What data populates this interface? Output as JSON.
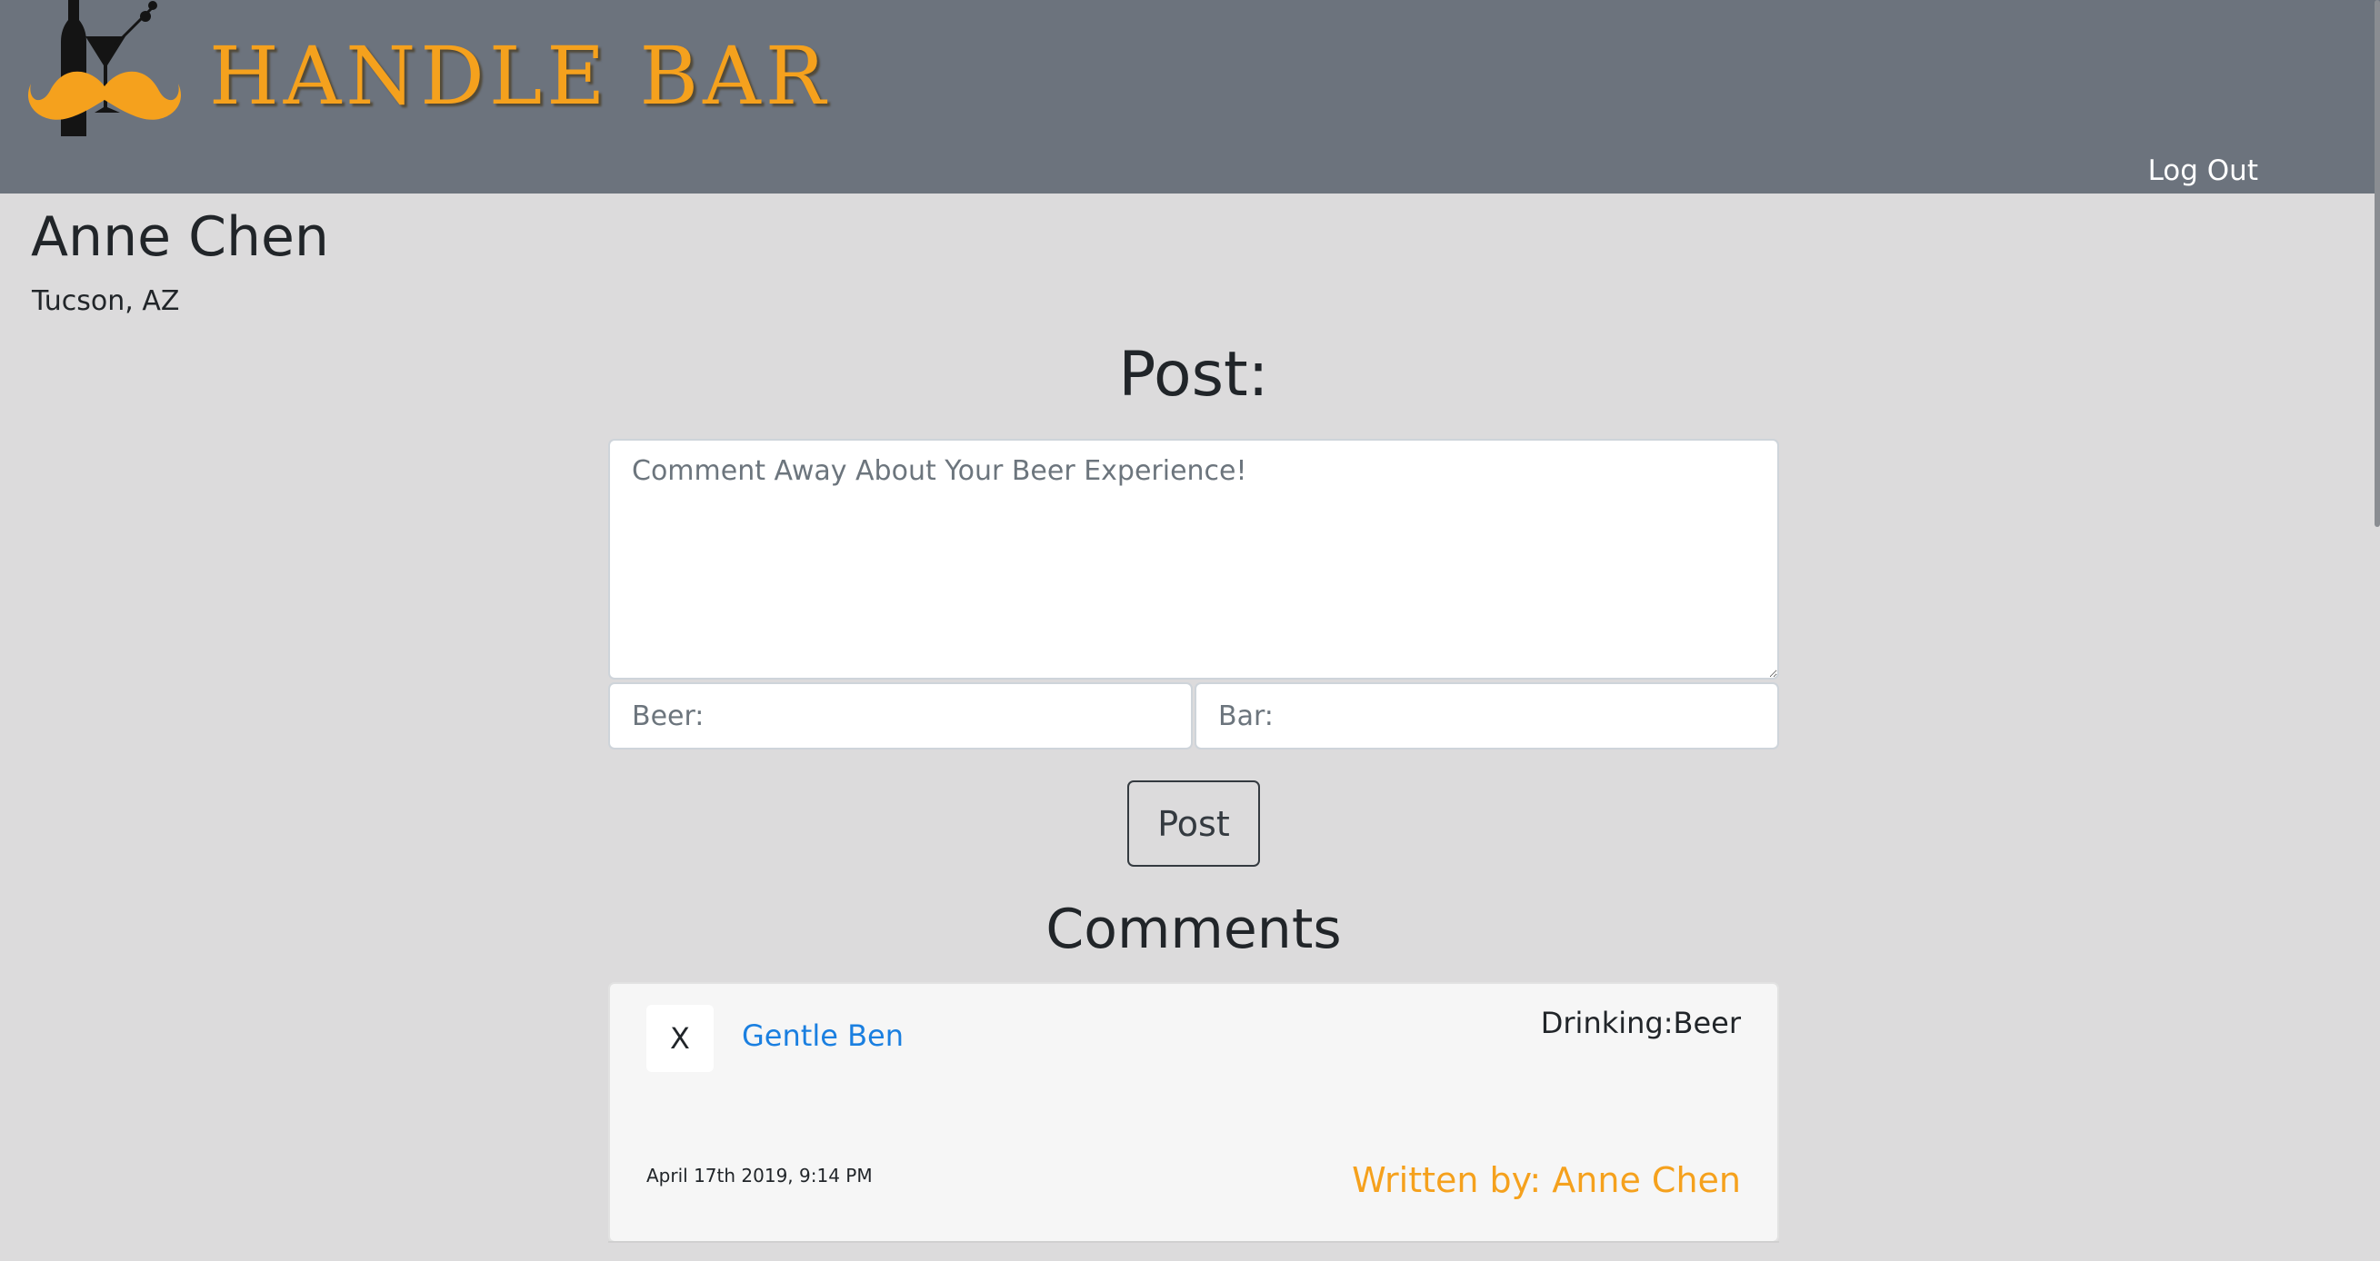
{
  "header": {
    "brand": "HANDLE BAR",
    "logout_label": "Log Out",
    "brand_color": "#f5a11d",
    "background_color": "#6c737d"
  },
  "profile": {
    "name": "Anne Chen",
    "location": "Tucson, AZ"
  },
  "post_form": {
    "title": "Post:",
    "comment_placeholder": "Comment Away About Your Beer Experience!",
    "beer_placeholder": "Beer:",
    "bar_placeholder": "Bar:",
    "submit_label": "Post"
  },
  "comments": {
    "title": "Comments",
    "items": [
      {
        "delete_label": "X",
        "bar": "Gentle Ben",
        "drinking": "Drinking:Beer",
        "timestamp": "April 17th 2019, 9:14 PM",
        "author": "Written by: Anne Chen"
      }
    ]
  },
  "icons": {
    "logo": "mustache-cocktail-logo"
  }
}
